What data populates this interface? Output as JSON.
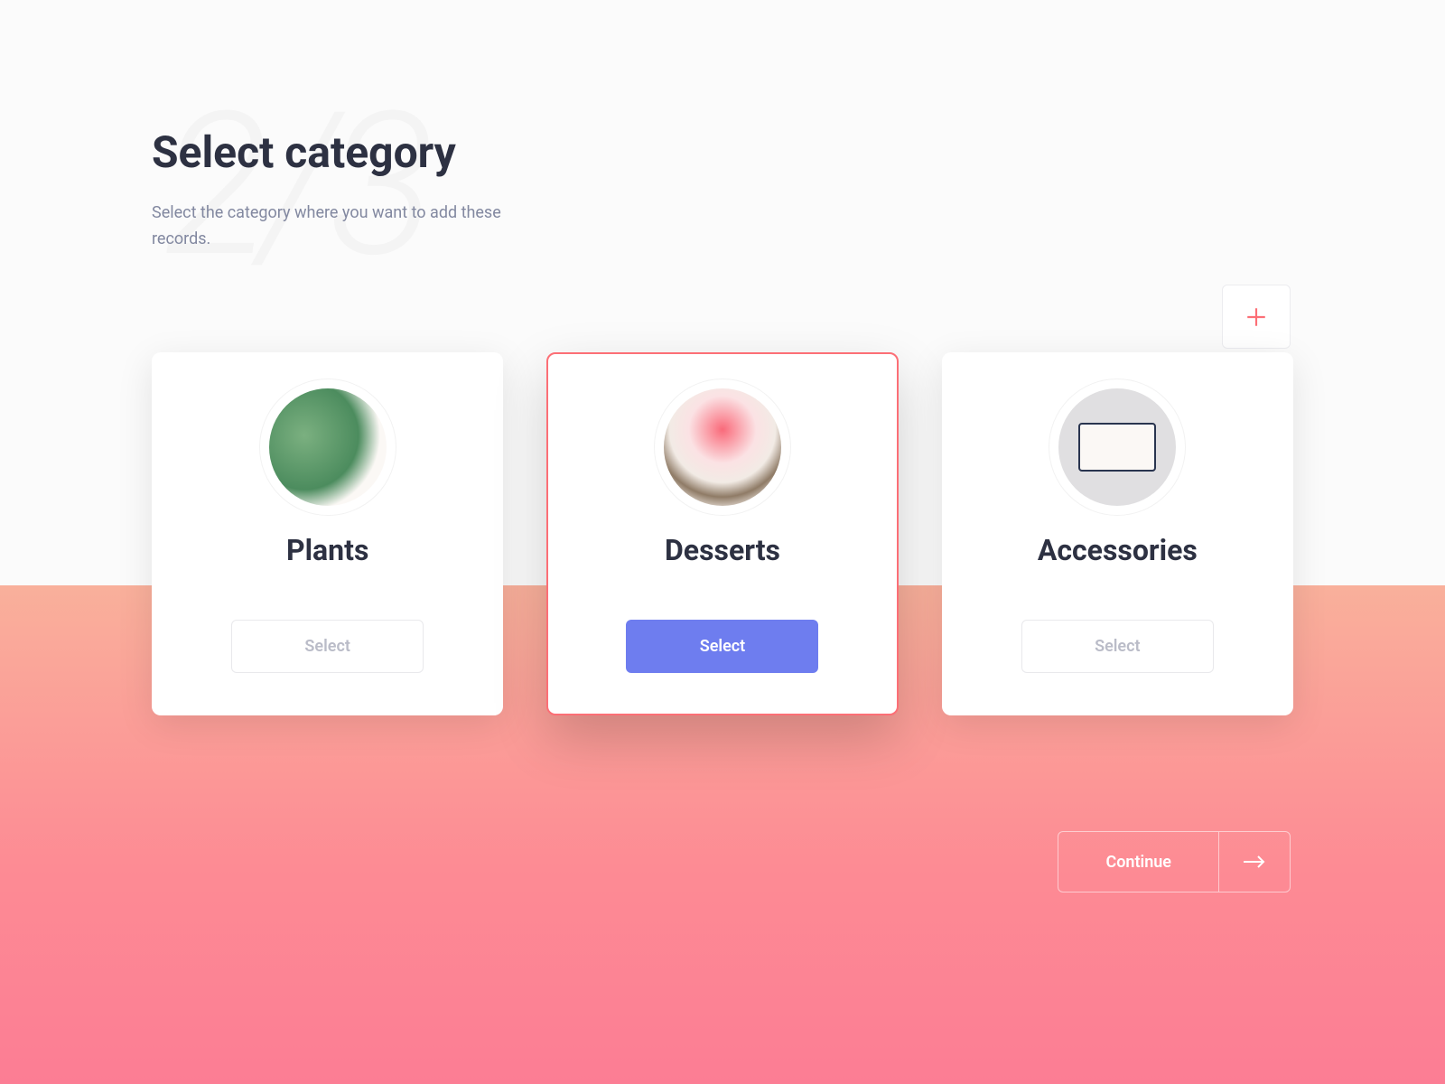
{
  "step": {
    "current": 2,
    "total": 3
  },
  "header": {
    "title": "Select category",
    "subtitle": "Select the category where you want to add these records."
  },
  "cards": [
    {
      "name": "Plants",
      "select_label": "Select",
      "selected": false,
      "image": "plants"
    },
    {
      "name": "Desserts",
      "select_label": "Select",
      "selected": true,
      "image": "desserts"
    },
    {
      "name": "Accessories",
      "select_label": "Select",
      "selected": false,
      "image": "accessories"
    }
  ],
  "actions": {
    "continue_label": "Continue"
  },
  "colors": {
    "accent": "#fc6f76",
    "primary": "#6e7def",
    "text_dark": "#2d3142"
  }
}
